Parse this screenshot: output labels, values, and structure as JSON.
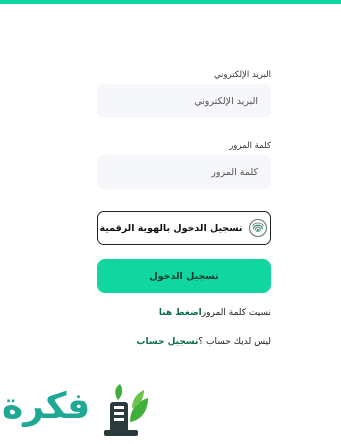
{
  "colors": {
    "accent": "#12d6a0",
    "link": "#0f6b4e",
    "input_bg": "#f6f7fb",
    "logo_teal": "#1fa894",
    "logo_green": "#3fae3a",
    "logo_dark": "#2b3a3d"
  },
  "form": {
    "email_label": "البريد الإلكتروني",
    "email_placeholder": "البريد الإلكتروني",
    "password_label": "كلمة المرور",
    "password_placeholder": "كلمة المرور",
    "digital_id_button": "تسجيل الدخول بالهوية الرقمية",
    "digital_id_icon": "fingerprint-icon",
    "login_button": "تسجيل الدخول",
    "forgot_text": "نسيت كلمة المرور",
    "forgot_link": "اضغط هنا",
    "no_account_text": "ليس لديك حساب ؟",
    "register_link": "تسجيل حساب"
  },
  "watermark": {
    "logo_text": "فكرة",
    "logo_icon": "book-leaf-logo"
  }
}
